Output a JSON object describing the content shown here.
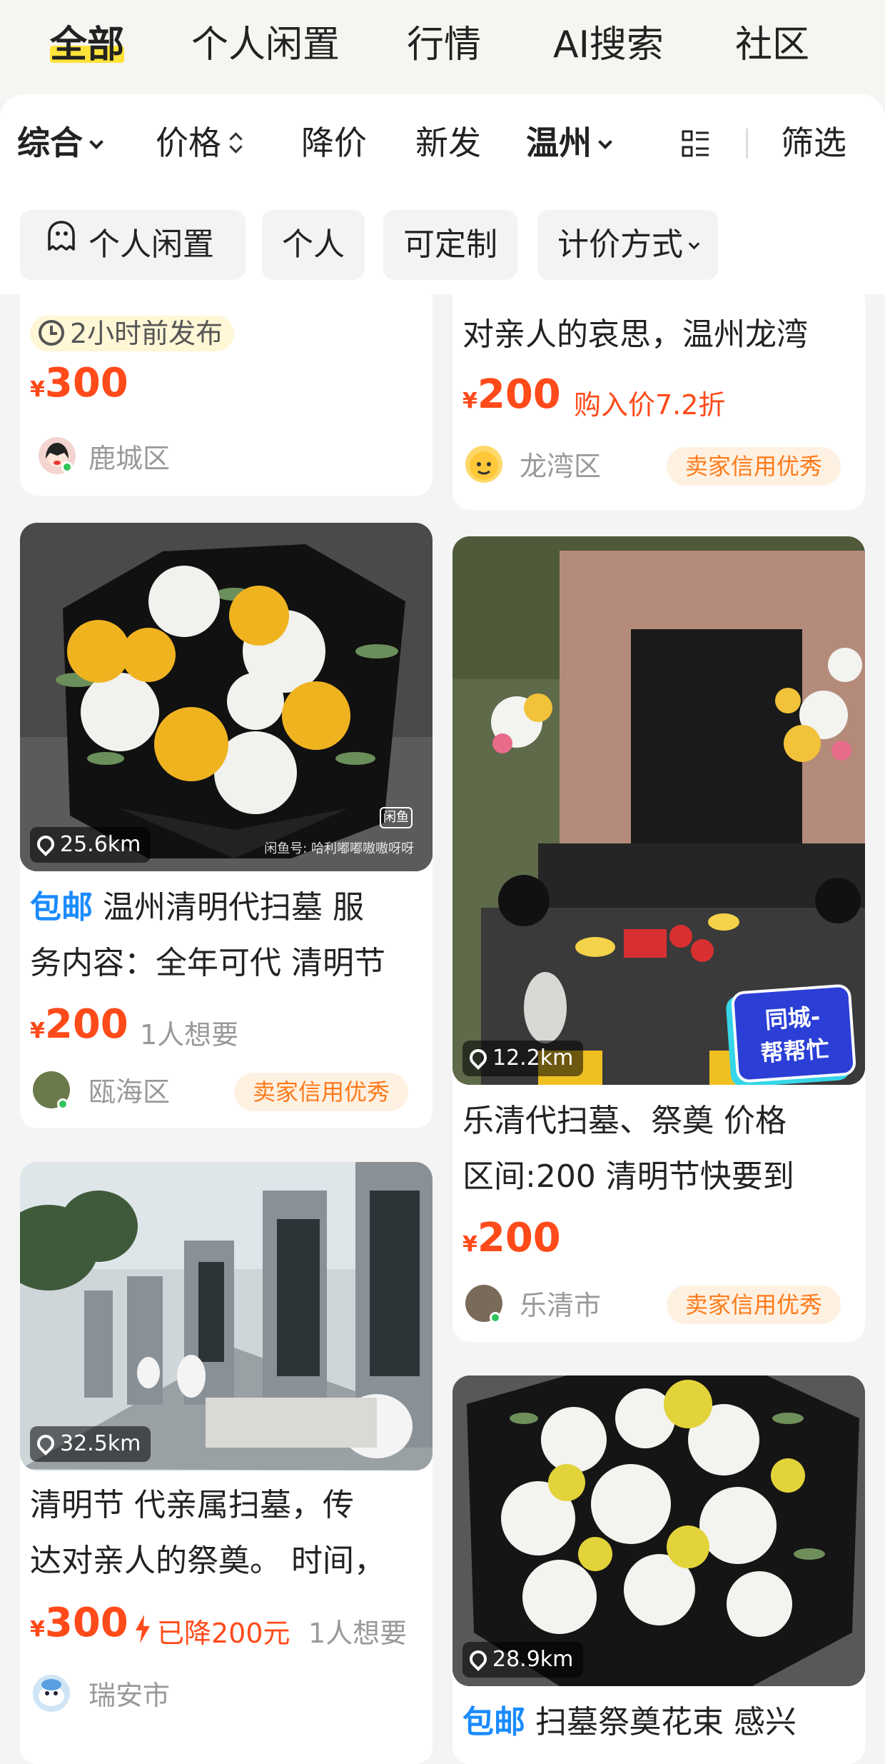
{
  "top_tabs": [
    "全部",
    "个人闲置",
    "行情",
    "AI搜索",
    "社区"
  ],
  "sort_bar": {
    "comprehensive": "综合",
    "price": "价格",
    "price_drop": "降价",
    "new": "新发",
    "city": "温州",
    "filter": "筛选"
  },
  "chips": [
    "个人闲置",
    "个人",
    "可定制",
    "计价方式"
  ],
  "cards": {
    "c1": {
      "time": "2小时前发布",
      "price": "300",
      "location": "鹿城区"
    },
    "c2": {
      "title": "对亲人的哀思，温州龙湾",
      "price": "200",
      "note": "购入价7.2折",
      "location": "龙湾区",
      "badge": "卖家信用优秀"
    },
    "c3": {
      "distance": "25.6km",
      "watermark": "闲鱼号: 哈利嘟嘟嗷嗷呀呀",
      "tag": "包邮",
      "title1": "温州清明代扫墓 服",
      "title2": "务内容：全年可代 清明节",
      "price": "200",
      "want": "1人想要",
      "location": "瓯海区",
      "badge": "卖家信用优秀"
    },
    "c4": {
      "distance": "12.2km",
      "sticker1": "同城-",
      "sticker2": "帮帮忙",
      "title1": "乐清代扫墓、祭奠 价格",
      "title2": "区间:200 清明节快要到",
      "price": "200",
      "location": "乐清市",
      "badge": "卖家信用优秀"
    },
    "c5": {
      "distance": "32.5km",
      "title1": "清明节  代亲属扫墓，传",
      "title2": "达对亲人的祭奠。 时间，",
      "price": "300",
      "drop": "已降200元",
      "want": "1人想要",
      "location": "瑞安市"
    },
    "c6": {
      "distance": "28.9km",
      "tag": "包邮",
      "title1": "扫墓祭奠花束 感兴"
    }
  },
  "colors": {
    "price_red": "#ff4a1a",
    "tab_highlight": "#ffe33a",
    "baoyou_blue": "#1a8bff",
    "badge_orange": "#ff7a1a"
  }
}
